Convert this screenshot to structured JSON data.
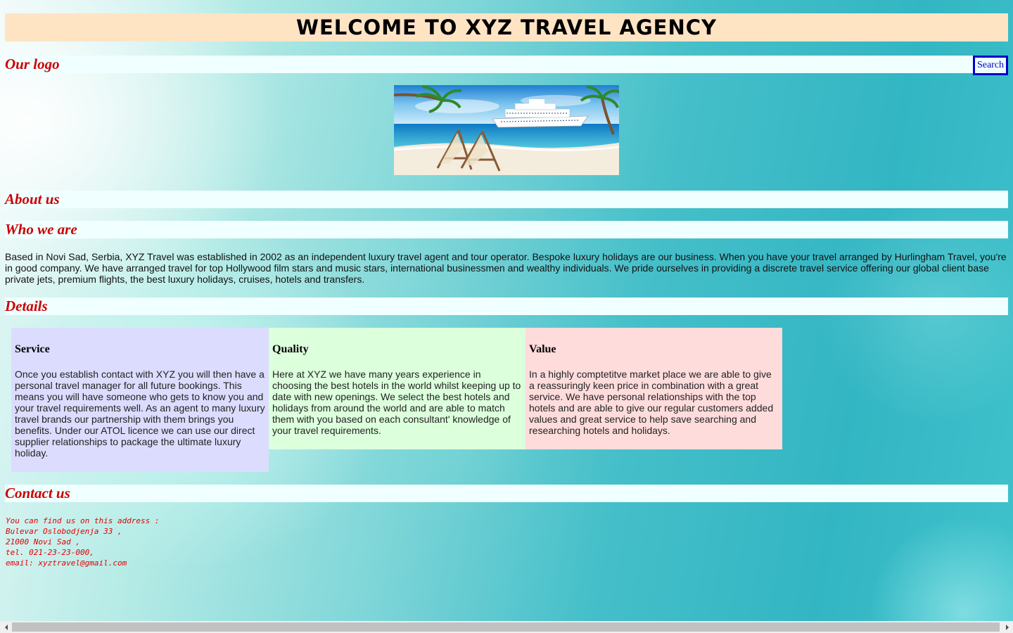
{
  "header": {
    "title": "WELCOME TO XYZ TRAVEL AGENCY"
  },
  "logo_bar": {
    "label": "Our logo",
    "search_label": "Search"
  },
  "hero_image": {
    "alt": "Beach with deck chairs and a cruise ship"
  },
  "sections": {
    "about": "About us",
    "who": "Who we are",
    "details": "Details",
    "contact": "Contact us"
  },
  "intro": "Based in Novi Sad, Serbia, XYZ Travel was established in 2002 as an independent luxury travel agent and tour operator. Bespoke luxury holidays are our business. When you have your travel arranged by Hurlingham Travel, you're in good company. We have arranged travel for top Hollywood film stars and music stars, international businessmen and wealthy individuals. We pride ourselves in providing a discrete travel service offering our global client base private jets, premium flights, the best luxury holidays, cruises, hotels and transfers.",
  "cards": [
    {
      "title": "Service",
      "text": "Once you establish contact with XYZ you will then have a personal travel manager for all future bookings. This means you will have someone who gets to know you and your travel requirements well. As an agent to many luxury travel brands our partnership with them brings you benefits. Under our ATOL licence we can use our direct supplier relationships to package the ultimate luxury holiday.",
      "color": "#dcdcff"
    },
    {
      "title": "Quality",
      "text": "Here at XYZ we have many years experience in choosing the best hotels in the world whilst keeping up to date with new openings. We select the best hotels and holidays from around the world and are able to match them with you based on each consultant' knowledge of your travel requirements.",
      "color": "#dcffdc"
    },
    {
      "title": "Value",
      "text": "In a highly comptetitve market place we are able to give a reassuringly keen price in combination with a great service. We have personal relationships with the top hotels and are able to give our regular customers added values and great service to help save searching and researching hotels and holidays.",
      "color": "#ffdcdc"
    }
  ],
  "contact": {
    "line1": "You can find us on this address :",
    "line2": "Bulevar Oslobodjenja 33 ,",
    "line3": "21000 Novi Sad ,",
    "line4": "tel. 021-23-23-000,",
    "line5": "email: xyztravel@gmail.com"
  },
  "colors": {
    "header_bg": "#ffe4c4",
    "band_bg": "#f0ffff",
    "heading_red": "#cc0000",
    "search_blue": "#0000cc"
  }
}
